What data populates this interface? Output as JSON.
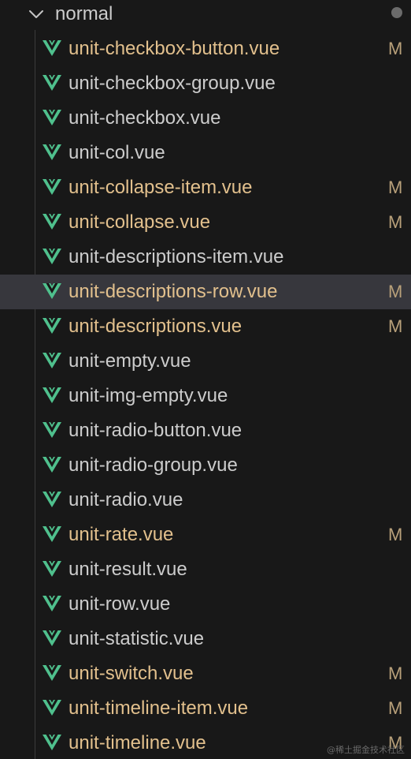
{
  "folder": {
    "name": "normal",
    "icon": "chevron-down-icon"
  },
  "colors": {
    "background": "#181818",
    "selected_row": "#37373d",
    "modified_text": "#e2c08d",
    "normal_text": "#cccccc",
    "vue_icon": "#4fc08d"
  },
  "files": [
    {
      "name": "unit-checkbox-button.vue",
      "status": "M",
      "modified": true
    },
    {
      "name": "unit-checkbox-group.vue",
      "status": "",
      "modified": false
    },
    {
      "name": "unit-checkbox.vue",
      "status": "",
      "modified": false
    },
    {
      "name": "unit-col.vue",
      "status": "",
      "modified": false
    },
    {
      "name": "unit-collapse-item.vue",
      "status": "M",
      "modified": true
    },
    {
      "name": "unit-collapse.vue",
      "status": "M",
      "modified": true
    },
    {
      "name": "unit-descriptions-item.vue",
      "status": "",
      "modified": false
    },
    {
      "name": "unit-descriptions-row.vue",
      "status": "M",
      "modified": true,
      "selected": true
    },
    {
      "name": "unit-descriptions.vue",
      "status": "M",
      "modified": true
    },
    {
      "name": "unit-empty.vue",
      "status": "",
      "modified": false
    },
    {
      "name": "unit-img-empty.vue",
      "status": "",
      "modified": false
    },
    {
      "name": "unit-radio-button.vue",
      "status": "",
      "modified": false
    },
    {
      "name": "unit-radio-group.vue",
      "status": "",
      "modified": false
    },
    {
      "name": "unit-radio.vue",
      "status": "",
      "modified": false
    },
    {
      "name": "unit-rate.vue",
      "status": "M",
      "modified": true
    },
    {
      "name": "unit-result.vue",
      "status": "",
      "modified": false
    },
    {
      "name": "unit-row.vue",
      "status": "",
      "modified": false
    },
    {
      "name": "unit-statistic.vue",
      "status": "",
      "modified": false
    },
    {
      "name": "unit-switch.vue",
      "status": "M",
      "modified": true
    },
    {
      "name": "unit-timeline-item.vue",
      "status": "M",
      "modified": true
    },
    {
      "name": "unit-timeline.vue",
      "status": "M",
      "modified": true
    }
  ],
  "watermark": "@稀土掘金技术社区"
}
